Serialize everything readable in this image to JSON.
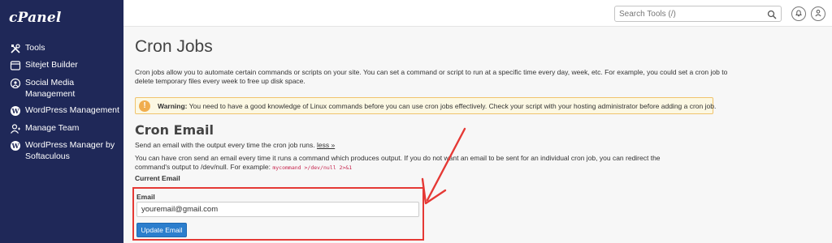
{
  "app": {
    "logo": "cPanel"
  },
  "sidebar": {
    "items": [
      {
        "label": "Tools",
        "icon": "tools-icon"
      },
      {
        "label": "Sitejet Builder",
        "icon": "sitejet-icon"
      },
      {
        "label": "Social Media Management",
        "icon": "social-media-icon"
      },
      {
        "label": "WordPress Management",
        "icon": "wordpress-icon"
      },
      {
        "label": "Manage Team",
        "icon": "manage-team-icon"
      },
      {
        "label": "WordPress Manager by Softaculous",
        "icon": "wordpress-icon"
      }
    ]
  },
  "header": {
    "search_placeholder": "Search Tools (/)",
    "icons": [
      "search-icon",
      "bell-icon",
      "user-icon"
    ]
  },
  "main": {
    "title": "Cron Jobs",
    "intro": "Cron jobs allow you to automate certain commands or scripts on your site. You can set a command or script to run at a specific time every day, week, etc. For example, you could set a cron job to delete temporary files every week to free up disk space.",
    "warning": {
      "label": "Warning:",
      "text": "You need to have a good knowledge of Linux commands before you can use cron jobs effectively. Check your script with your hosting administrator before adding a cron job."
    },
    "cron_email": {
      "title": "Cron Email",
      "description": "Send an email with the output every time the cron job runs.",
      "less_link": "less »",
      "details": "You can have cron send an email every time it runs a command which produces output. If you do not want an email to be sent for an individual cron job, you can redirect the command's output to /dev/null. For example:",
      "example_code": "mycommand >/dev/null 2>&1",
      "current_email_label": "Current Email",
      "email_label": "Email",
      "email_value": "youremail@gmail.com",
      "update_button": "Update Email"
    }
  },
  "colors": {
    "sidebar_bg": "#1f2858",
    "primary_button": "#2c7ecd",
    "warning_bg": "#fcf8e3",
    "annotation_red": "#e53935"
  }
}
